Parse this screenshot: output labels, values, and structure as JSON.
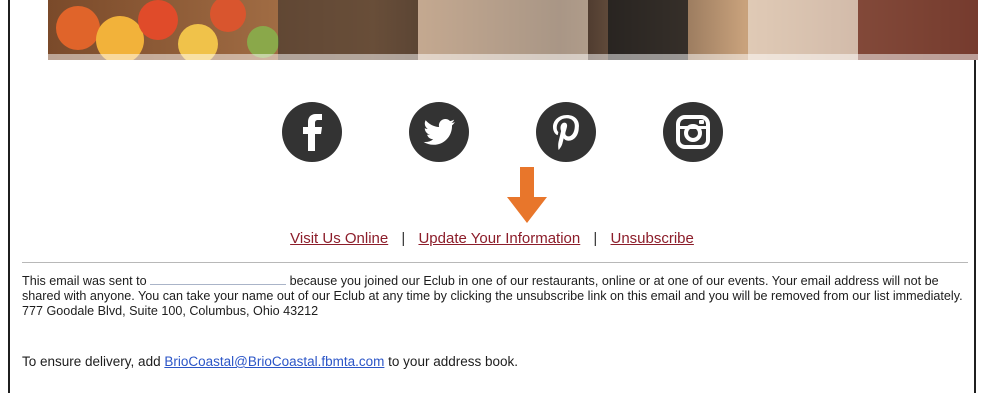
{
  "social": {
    "facebook": "facebook-icon",
    "twitter": "twitter-icon",
    "pinterest": "pinterest-icon",
    "instagram": "instagram-icon",
    "icon_color": "#333333"
  },
  "arrow_color": "#e8762b",
  "links": {
    "visit": "Visit Us Online",
    "update": "Update Your Information",
    "unsubscribe": "Unsubscribe",
    "separator": "|",
    "link_color": "#8c1d2a"
  },
  "disclaimer": {
    "part1": "This email was sent to",
    "part2": "because you joined our Eclub in one of our restaurants, online or at one of our events. Your email address will not be shared with anyone. You can take your name out of our Eclub at any time by clicking the unsubscribe link on this email and you will be removed from our list immediately. 777 Goodale Blvd, Suite 100, Columbus, Ohio 43212"
  },
  "delivery": {
    "prefix": "To ensure delivery, add",
    "email": "BrioCoastal@BrioCoastal.fbmta.com",
    "suffix": "to your address book."
  }
}
